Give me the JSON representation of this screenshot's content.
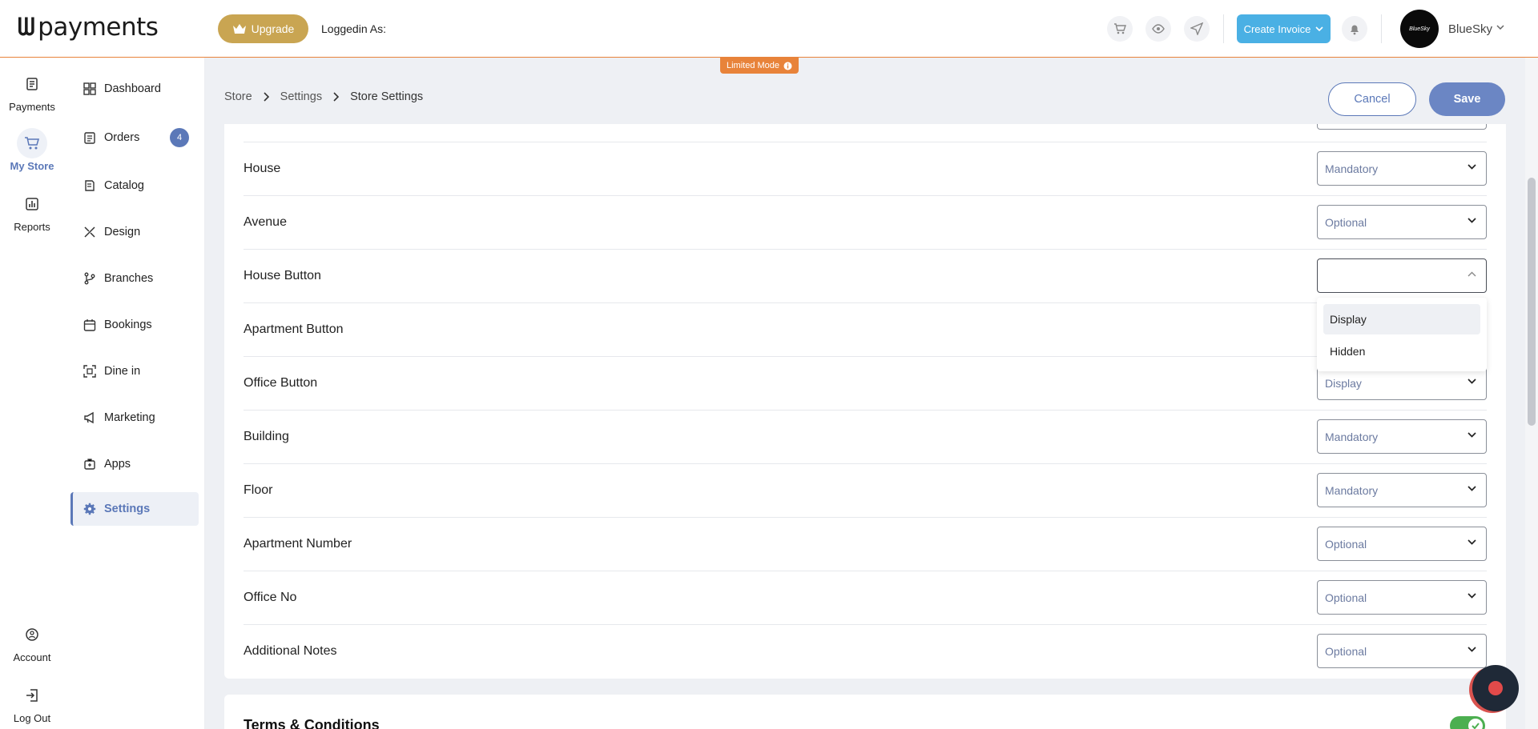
{
  "topbar": {
    "logo_text": "payments",
    "upgrade_label": "Upgrade",
    "logged_in_text": "Loggedin As:",
    "create_invoice_label": "Create Invoice",
    "avatar_text": "BlueSky",
    "user_name": "BlueSky",
    "limited_mode_label": "Limited Mode"
  },
  "rail": {
    "payments": "Payments",
    "my_store": "My Store",
    "reports": "Reports",
    "account": "Account",
    "logout": "Log Out"
  },
  "subnav": {
    "dashboard": "Dashboard",
    "orders": "Orders",
    "orders_badge": "4",
    "catalog": "Catalog",
    "design": "Design",
    "branches": "Branches",
    "bookings": "Bookings",
    "dine_in": "Dine in",
    "marketing": "Marketing",
    "apps": "Apps",
    "settings": "Settings"
  },
  "header": {
    "crumb_store": "Store",
    "crumb_settings": "Settings",
    "crumb_current": "Store Settings",
    "cancel_label": "Cancel",
    "save_label": "Save"
  },
  "fields": {
    "house": {
      "label": "House",
      "value": "Mandatory"
    },
    "avenue": {
      "label": "Avenue",
      "value": "Optional"
    },
    "house_button": {
      "label": "House Button",
      "value": ""
    },
    "apartment_button": {
      "label": "Apartment Button"
    },
    "office_button": {
      "label": "Office Button",
      "value": "Display"
    },
    "building": {
      "label": "Building",
      "value": "Mandatory"
    },
    "floor": {
      "label": "Floor",
      "value": "Mandatory"
    },
    "apartment_number": {
      "label": "Apartment Number",
      "value": "Optional"
    },
    "office_no": {
      "label": "Office No",
      "value": "Optional"
    },
    "additional_notes": {
      "label": "Additional Notes",
      "value": "Optional"
    }
  },
  "dropdown": {
    "options": [
      "Display",
      "Hidden"
    ]
  },
  "terms": {
    "title": "Terms & Conditions",
    "enabled": true
  }
}
